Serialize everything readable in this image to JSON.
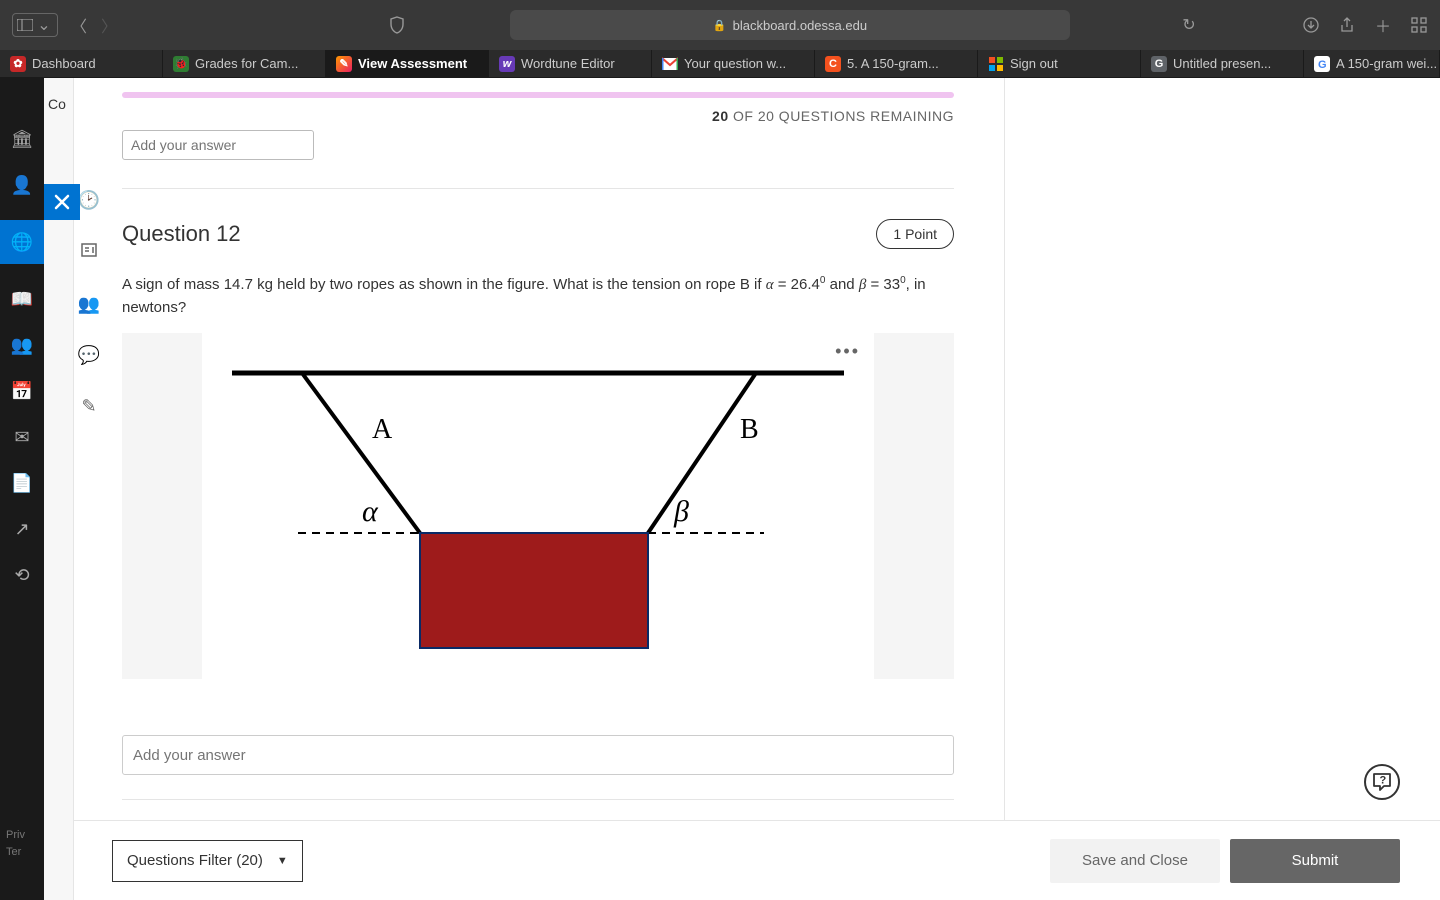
{
  "browser": {
    "url": "blackboard.odessa.edu"
  },
  "tabs": [
    {
      "label": "Dashboard"
    },
    {
      "label": "Grades for Cam..."
    },
    {
      "label": "View Assessment"
    },
    {
      "label": "Wordtune Editor"
    },
    {
      "label": "Your question w..."
    },
    {
      "label": "5.   A 150-gram..."
    },
    {
      "label": "Sign out"
    },
    {
      "label": "Untitled presen..."
    },
    {
      "label": "A 150-gram wei..."
    }
  ],
  "grey_rail": {
    "co": "Co"
  },
  "progress": {
    "done": "20",
    "remaining_text": " OF 20 QUESTIONS REMAINING"
  },
  "prev_input_placeholder": "Add your answer",
  "question": {
    "title": "Question 12",
    "points": "1 Point",
    "text_pre": "A sign of mass 14.7 kg held by two ropes as shown in the figure. What is the tension on rope B if ",
    "alpha_sym": "α",
    "eq1": " = 26.4",
    "deg1": "0",
    "mid": " and ",
    "beta_sym": "β",
    "eq2": " = 33",
    "deg2": "0",
    "text_post": ", in newtons?"
  },
  "figure": {
    "labelA": "A",
    "labelB": "B",
    "alpha": "α",
    "beta": "β",
    "more": "•••"
  },
  "answer_placeholder": "Add your answer",
  "bottom": {
    "filter": "Questions Filter (20)",
    "save": "Save and Close",
    "submit": "Submit"
  },
  "help": "?",
  "footer": {
    "l1": "Priv",
    "l2": "Ter"
  }
}
